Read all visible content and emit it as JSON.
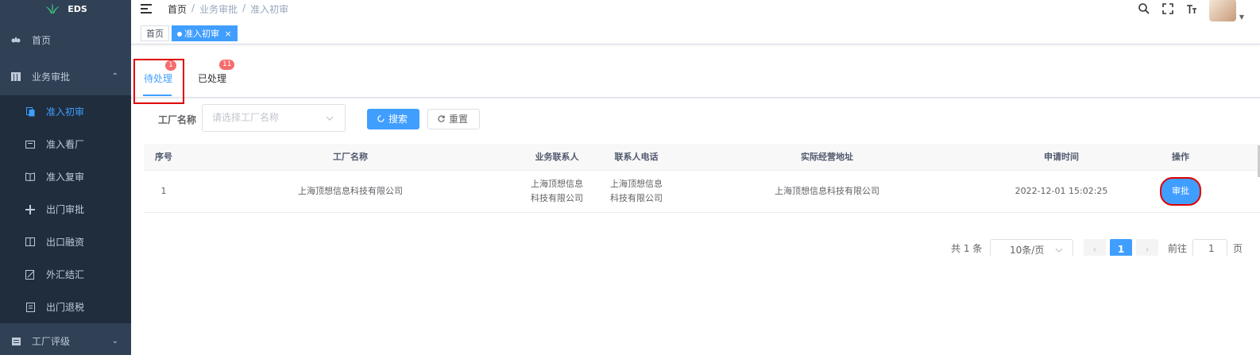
{
  "app": {
    "name": "EDS"
  },
  "sidebar": {
    "items": [
      {
        "label": "首页",
        "icon": "dashboard-icon"
      },
      {
        "label": "业务审批",
        "icon": "table-icon",
        "arrow": "⌃"
      }
    ],
    "subitems": [
      {
        "label": "准入初审",
        "icon": "copy-icon",
        "active": true
      },
      {
        "label": "准入看厂",
        "icon": "tab-icon"
      },
      {
        "label": "准入复审",
        "icon": "book-icon"
      },
      {
        "label": "出门审批",
        "icon": "move-icon"
      },
      {
        "label": "出口融资",
        "icon": "build-icon"
      },
      {
        "label": "外汇结汇",
        "icon": "edit-icon"
      },
      {
        "label": "出门退税",
        "icon": "doc-icon"
      }
    ],
    "bottom": {
      "label": "工厂评级",
      "icon": "list-icon",
      "arrow": "⌄"
    }
  },
  "navbar": {
    "breadcrumb": [
      "首页",
      "/",
      "业务审批",
      "/",
      "准入初审"
    ]
  },
  "tagsview": {
    "tags": [
      {
        "label": "首页",
        "active": false
      },
      {
        "label": "准入初审",
        "active": true,
        "close": "×"
      }
    ]
  },
  "tabs": [
    {
      "label": "待处理",
      "badge": "1",
      "active": true
    },
    {
      "label": "已处理",
      "badge": "11",
      "active": false
    }
  ],
  "filter": {
    "label": "工厂名称",
    "placeholder": "请选择工厂名称",
    "search_label": "搜索",
    "reset_label": "重置"
  },
  "table": {
    "headers": [
      "序号",
      "工厂名称",
      "业务联系人",
      "联系人电话",
      "实际经营地址",
      "申请时间",
      "操作"
    ],
    "rows": [
      {
        "index": "1",
        "factory": "上海顶想信息科技有限公司",
        "contact_line1": "上海顶想信息",
        "contact_line2": "科技有限公司",
        "phone_line1": "上海顶想信息",
        "phone_line2": "科技有限公司",
        "address": "上海顶想信息科技有限公司",
        "time": "2022-12-01 15:02:25",
        "action": "审批"
      }
    ]
  },
  "pagination": {
    "total": "共 1 条",
    "page_size": "10条/页",
    "current_page": "1",
    "goto_label": "前往",
    "goto_value": "1",
    "page_suffix": "页"
  },
  "colors": {
    "primary": "#409eff",
    "sidebar": "#304156",
    "badge": "#f56c6c",
    "highlight": "#e00000"
  }
}
